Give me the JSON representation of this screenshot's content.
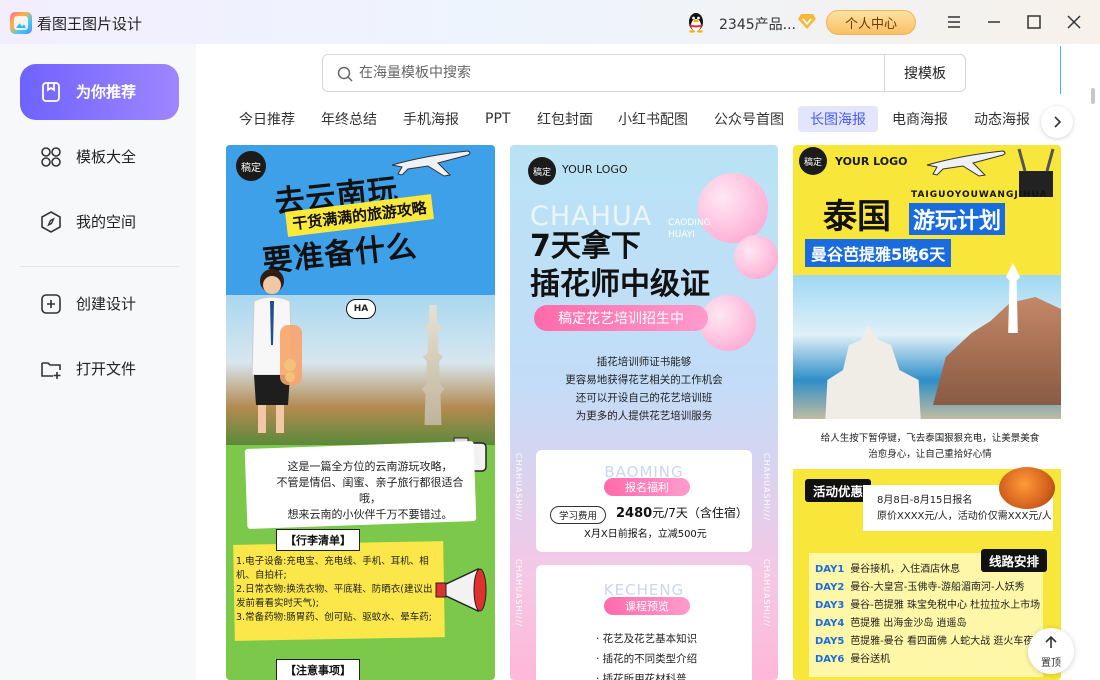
{
  "app": {
    "title": "看图王图片设计",
    "user_name": "2345产品...",
    "personal_center": "个人中心"
  },
  "sidebar": {
    "items": [
      {
        "label": "为你推荐",
        "icon": "bookmark-icon"
      },
      {
        "label": "模板大全",
        "icon": "grid-icon"
      },
      {
        "label": "我的空间",
        "icon": "compass-icon"
      },
      {
        "label": "创建设计",
        "icon": "plus-square-icon"
      },
      {
        "label": "打开文件",
        "icon": "folder-plus-icon"
      }
    ]
  },
  "search": {
    "placeholder": "在海量模板中搜索",
    "button": "搜模板"
  },
  "tabs": [
    "今日推荐",
    "年终总结",
    "手机海报",
    "PPT",
    "红包封面",
    "小红书配图",
    "公众号首图",
    "长图海报",
    "电商海报",
    "动态海报"
  ],
  "active_tab": "长图海报",
  "cards": [
    {
      "tag": "稿定",
      "title_line1": "去云南玩",
      "subtitle": "干货满满的旅游攻略",
      "title_line2": "要准备什么",
      "speech": "HA",
      "intro": [
        "这是一篇全方位的云南游玩攻略，",
        "不管是情侣、闺蜜、亲子旅行都很适合哦，",
        "想来云南的小伙伴千万不要错过。"
      ],
      "list_title": "【行李清单】",
      "list": [
        "1.电子设备:充电宝、充电线、手机、耳机、相机、自拍杆;",
        "2.日常衣物:换洗衣物、平底鞋、防晒衣(建议出发前看看实时天气);",
        "3.常备药物:肠胃药、创可贴、驱蚊水、晕车药;"
      ],
      "note_title": "【注意事项】"
    },
    {
      "tag": "稿定",
      "logo": "YOUR LOGO",
      "ghost_title": "CHAHUA",
      "ghost_sub": [
        "CAODING",
        "HUAYI"
      ],
      "title_line1": "7天拿下",
      "title_line2": "插花师中级证",
      "pill": "稿定花艺培训招生中",
      "desc": [
        "插花培训师证书能够",
        "更容易地获得花艺相关的工作机会",
        "还可以开设自己的花艺培训班",
        "为更多的人提供花艺培训服务"
      ],
      "box1_ghost": "BAOMING",
      "box1_tag": "报名福利",
      "fee_label": "学习费用",
      "fee_value": "2480",
      "fee_unit": "元/7天（含住宿）",
      "fee_note": "X月X日前报名，立减500元",
      "box2_ghost": "KECHENG",
      "box2_tag": "课程预览",
      "courses": [
        "· 花艺及花艺基本知识",
        "· 插花的不同类型介绍",
        "· 插花所用花材科普"
      ],
      "side_text": "CHAHUASHI///"
    },
    {
      "tag": "稿定",
      "logo": "YOUR LOGO",
      "pinyin": "TAIGUOYOUWANGJIHUA",
      "title_a": "泰国",
      "title_b": "游玩计划",
      "banner": "曼谷芭提雅5晚6天",
      "intro": [
        "给人生按下暂停键，飞去泰国狠狠充电，让美景美食",
        "治愈身心，让自己重拾好心情"
      ],
      "offer_badge": "活动优惠",
      "offer": [
        "8月8日-8月15日报名",
        "原价XXXX元/人，活动价仅需XXX元/人"
      ],
      "route_badge": "线路安排",
      "days": [
        {
          "day": "DAY1",
          "text": "曼谷接机，入住酒店休息"
        },
        {
          "day": "DAY2",
          "text": "曼谷-大皇宫-玉佛寺-游船湄南河-人妖秀"
        },
        {
          "day": "DAY3",
          "text": "曼谷-芭提雅 珠宝免税中心 杜拉拉水上市场"
        },
        {
          "day": "DAY4",
          "text": "芭提雅 出海金沙岛 逍遥岛"
        },
        {
          "day": "DAY5",
          "text": "芭提雅-曼谷 看四面佛 人蛇大战 逛火车夜市"
        },
        {
          "day": "DAY6",
          "text": "曼谷送机"
        }
      ]
    }
  ],
  "back_to_top": "置顶",
  "colors": {
    "accent": "#7B6BFF",
    "active_tab_bg": "#E3E6FB",
    "active_tab_text": "#4A5CF0",
    "vip_gold": "#F8C064"
  }
}
